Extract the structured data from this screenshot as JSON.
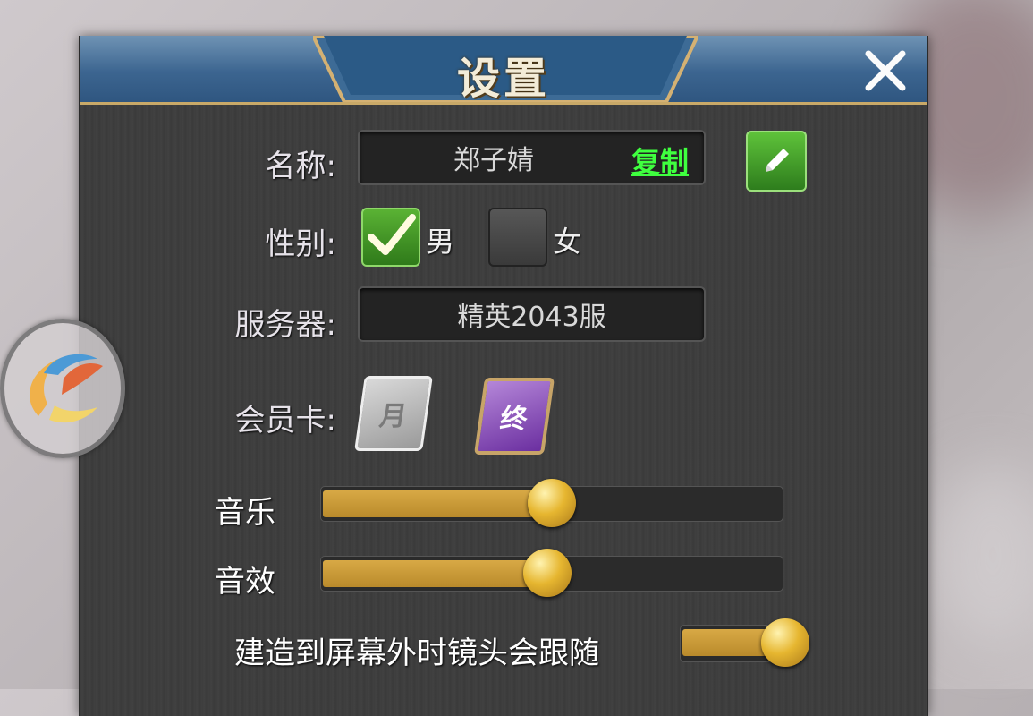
{
  "window": {
    "title": "设置"
  },
  "profile": {
    "name_label": "名称:",
    "name_value": "郑子婧",
    "copy_label": "复制",
    "gender_label": "性别:",
    "gender_male": "男",
    "gender_female": "女",
    "gender_selected": "male",
    "server_label": "服务器:",
    "server_value": "精英2043服",
    "vip_label": "会员卡:",
    "cards": [
      {
        "glyph": "月",
        "name": "month-card"
      },
      {
        "glyph": "终",
        "name": "lifetime-card"
      }
    ]
  },
  "audio": {
    "music_label": "音乐",
    "music_level": 0.5,
    "sfx_label": "音效",
    "sfx_level": 0.49
  },
  "options": {
    "camera_follow_label": "建造到屏幕外时镜头会跟随",
    "camera_follow_on": true
  },
  "colors": {
    "accent_gold": "#d8a945",
    "link_green": "#3fff3f",
    "checkbox_green": "#4ea52c"
  }
}
